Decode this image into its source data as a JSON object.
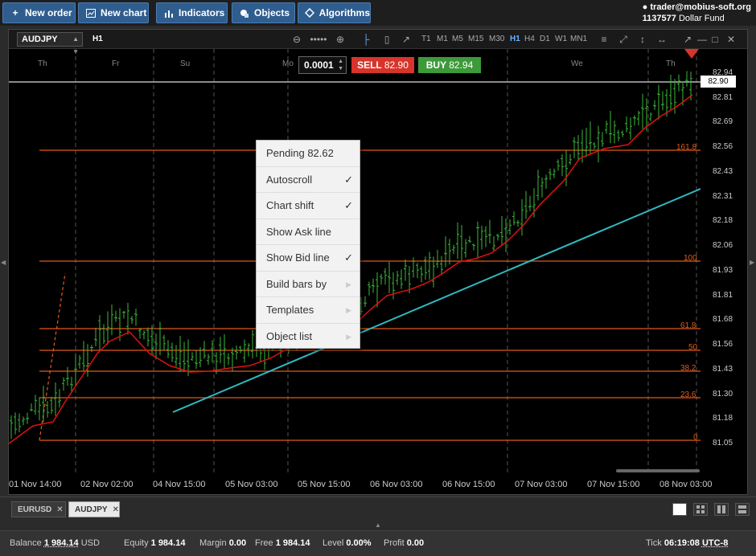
{
  "toolbar": {
    "new_order": "New order",
    "new_chart": "New chart",
    "indicators": "Indicators",
    "objects": "Objects",
    "algorithms": "Algorithms"
  },
  "account": {
    "user": "trader@mobius-soft.org",
    "id": "1137577",
    "fund": "Dollar Fund"
  },
  "chart": {
    "symbol": "AUDJPY",
    "timeframe": "H1",
    "timeframes": [
      "T1",
      "M1",
      "M5",
      "M15",
      "M30",
      "H1",
      "H4",
      "D1",
      "W1",
      "MN1"
    ],
    "active_timeframe": "H1",
    "days": [
      "Th",
      "Fr",
      "Su",
      "Mo",
      "We",
      "Th"
    ],
    "price_axis": [
      "82.94",
      "82.81",
      "82.69",
      "82.56",
      "82.43",
      "82.31",
      "82.18",
      "82.06",
      "81.93",
      "81.81",
      "81.68",
      "81.56",
      "81.43",
      "81.30",
      "81.18",
      "81.05"
    ],
    "current_price": "82.90",
    "time_axis": [
      "01 Nov 14:00",
      "02 Nov 02:00",
      "04 Nov 15:00",
      "05 Nov 03:00",
      "05 Nov 15:00",
      "06 Nov 03:00",
      "06 Nov 15:00",
      "07 Nov 03:00",
      "07 Nov 15:00",
      "08 Nov 03:00"
    ],
    "fib_levels": [
      "161.8",
      "100",
      "61.8",
      "50",
      "38.2",
      "23.6",
      "0"
    ],
    "colors": {
      "background": "#000000",
      "fib": "#e05a1a",
      "ma": "#e01010",
      "trendline": "#2fb8c0",
      "bar": "#3cb83c",
      "sell": "#d9342b",
      "buy": "#3d9a3a"
    }
  },
  "order": {
    "quantity": "0.0001",
    "sell_label": "SELL",
    "sell_price": "82.90",
    "buy_label": "BUY",
    "buy_price": "82.94"
  },
  "context_menu": {
    "items": [
      {
        "label": "Pending 82.62",
        "check": "",
        "sub": ""
      },
      {
        "label": "Autoscroll",
        "check": "✓",
        "sub": ""
      },
      {
        "label": "Chart shift",
        "check": "✓",
        "sub": ""
      },
      {
        "label": "Show Ask line",
        "check": "",
        "sub": ""
      },
      {
        "label": "Show Bid line",
        "check": "✓",
        "sub": ""
      },
      {
        "label": "Build bars by",
        "check": "",
        "sub": "▶"
      },
      {
        "label": "Templates",
        "check": "",
        "sub": "▶"
      },
      {
        "label": "Object list",
        "check": "",
        "sub": "▶"
      }
    ]
  },
  "tabs": [
    {
      "label": "EURUSD",
      "active": false
    },
    {
      "label": "AUDJPY",
      "active": true
    }
  ],
  "status": {
    "balance_label": "Balance",
    "balance": "1 984.14",
    "currency": "USD",
    "equity_label": "Equity",
    "equity": "1 984.14",
    "margin_label": "Margin",
    "margin": "0.00",
    "free_label": "Free",
    "free": "1 984.14",
    "level_label": "Level",
    "level": "0.00%",
    "profit_label": "Profit",
    "profit": "0.00",
    "tick_label": "Tick",
    "tick": "06:19:08",
    "tz": "UTC-8"
  }
}
